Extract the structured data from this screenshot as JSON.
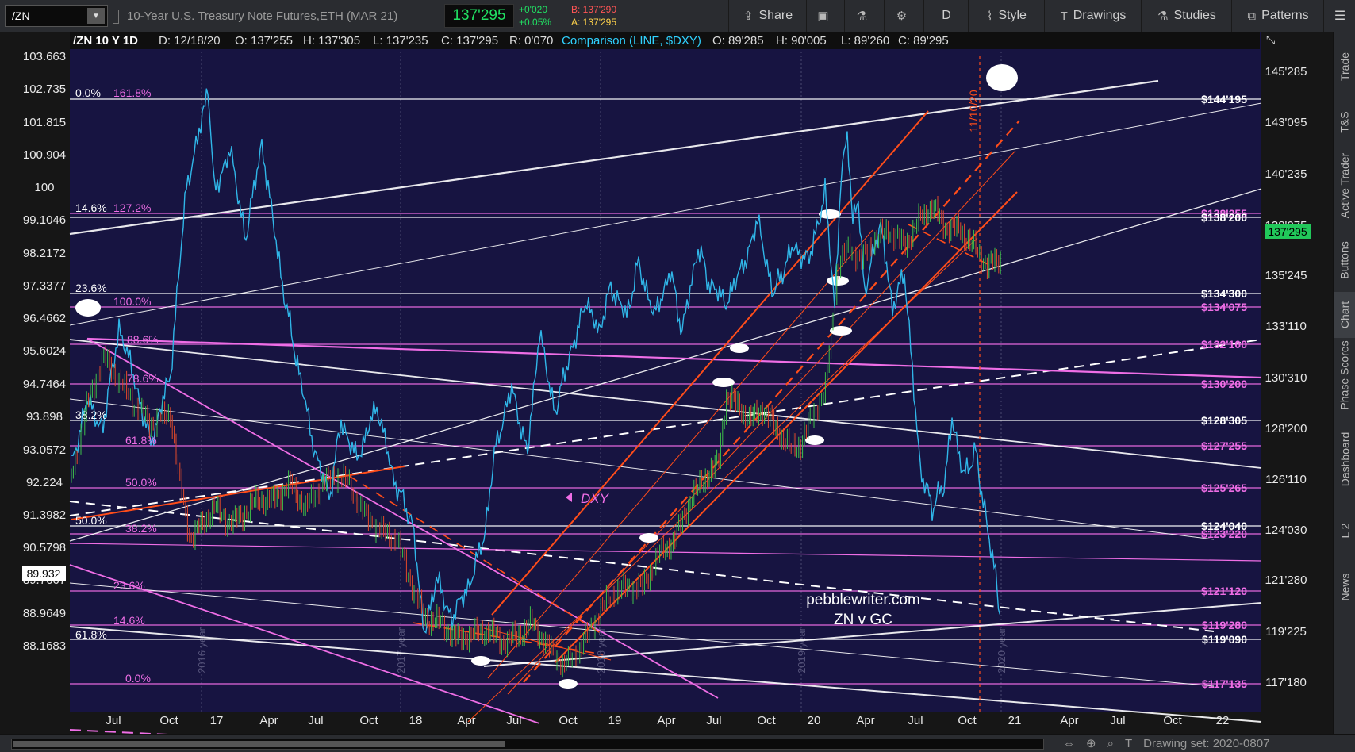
{
  "topbar": {
    "symbol": "/ZN",
    "description": "10-Year U.S. Treasury Note Futures,ETH (MAR 21)",
    "last_price": "137'295",
    "change_abs": "+0'020",
    "change_pct": "+0.05%",
    "bid": "B: 137'290",
    "ask": "A: 137'295",
    "share_label": "Share",
    "period_label": "D",
    "style_label": "Style",
    "drawings_label": "Drawings",
    "studies_label": "Studies",
    "patterns_label": "Patterns"
  },
  "right_panel": {
    "tabs": [
      "Trade",
      "T&S",
      "Active Trader",
      "Buttons",
      "Chart",
      "Phase Scores",
      "Dashboard",
      "L 2",
      "News"
    ],
    "active_tab": "Chart"
  },
  "bottom_bar": {
    "drawing_set": "Drawing set: 2020-0807"
  },
  "colors": {
    "background": "#171441",
    "price_candles_up": "#3ec24a",
    "price_candles_down": "#e44a2a",
    "comparison_line": "#30b6e8",
    "fib_magenta": "#ef6ee6",
    "white_lines": "#ffffff",
    "channel_red": "#ff4d1a"
  },
  "chart_data": {
    "type": "line",
    "header": {
      "symbol_period": "/ZN 10 Y 1D",
      "date": "D: 12/18/20",
      "open": "O: 137'255",
      "high": "H: 137'305",
      "low": "L: 137'235",
      "close": "C: 137'295",
      "range": "R: 0'070",
      "comparison_label": "Comparison (LINE, $DXY)",
      "cmp_open": "O: 89'285",
      "cmp_high": "H: 90'005",
      "cmp_low": "L: 89'260",
      "cmp_close": "C: 89'295"
    },
    "left_axis_ticks": [
      "103.663",
      "102.735",
      "101.815",
      "100.904",
      "100",
      "99.1046",
      "98.2172",
      "97.3377",
      "96.4662",
      "95.6024",
      "94.7464",
      "93.898",
      "93.0572",
      "92.224",
      "91.3982",
      "90.5798",
      "89.7667",
      "88.9649",
      "88.1683"
    ],
    "left_axis_current": "89.932",
    "right_axis_ticks": [
      "145'285",
      "143'095",
      "140'235",
      "138'075",
      "135'245",
      "133'110",
      "130'310",
      "128'200",
      "126'110",
      "124'030",
      "121'280",
      "119'225",
      "117'180"
    ],
    "right_axis_current": "137'295",
    "x_ticks": [
      "Jul",
      "Oct",
      "17",
      "Apr",
      "Jul",
      "Oct",
      "18",
      "Apr",
      "Jul",
      "Oct",
      "19",
      "Apr",
      "Jul",
      "Oct",
      "20",
      "Apr",
      "Jul",
      "Oct",
      "21",
      "Apr",
      "Jul",
      "Oct",
      "22"
    ],
    "year_markers": [
      "2016 year",
      "2017 year",
      "2018 year",
      "2019 year",
      "2020 year"
    ],
    "date_annotation": "11/10/20",
    "right_fib_levels": [
      {
        "label": "$144'195",
        "color": "white"
      },
      {
        "label": "$138'255",
        "color": "magenta"
      },
      {
        "label": "$138'200",
        "color": "white"
      },
      {
        "label": "$134'300",
        "color": "white"
      },
      {
        "label": "$134'075",
        "color": "magenta"
      },
      {
        "label": "$132'100",
        "color": "magenta"
      },
      {
        "label": "$130'200",
        "color": "magenta"
      },
      {
        "label": "$128'305",
        "color": "white"
      },
      {
        "label": "$127'255",
        "color": "magenta"
      },
      {
        "label": "$125'265",
        "color": "magenta"
      },
      {
        "label": "$124'040",
        "color": "white"
      },
      {
        "label": "$123'220",
        "color": "magenta"
      },
      {
        "label": "$121'120",
        "color": "magenta"
      },
      {
        "label": "$119'280",
        "color": "magenta"
      },
      {
        "label": "$119'090",
        "color": "white"
      },
      {
        "label": "$117'135",
        "color": "magenta"
      }
    ],
    "left_fib_labels": [
      {
        "label": "0.0%",
        "color": "white"
      },
      {
        "label": "161.8%",
        "color": "magenta"
      },
      {
        "label": "14.6%",
        "color": "white"
      },
      {
        "label": "127.2%",
        "color": "magenta"
      },
      {
        "label": "23.6%",
        "color": "white"
      },
      {
        "label": "100.0%",
        "color": "magenta"
      },
      {
        "label": "88.6%",
        "color": "magenta"
      },
      {
        "label": "78.6%",
        "color": "magenta"
      },
      {
        "label": "38.2%",
        "color": "white"
      },
      {
        "label": "61.8%",
        "color": "magenta"
      },
      {
        "label": "50.0%",
        "color": "magenta"
      },
      {
        "label": "50.0%",
        "color": "white"
      },
      {
        "label": "38.2%",
        "color": "magenta"
      },
      {
        "label": "23.6%",
        "color": "magenta"
      },
      {
        "label": "14.6%",
        "color": "magenta"
      },
      {
        "label": "61.8%",
        "color": "white"
      },
      {
        "label": "0.0%",
        "color": "magenta"
      }
    ],
    "annotations": {
      "dxy_label": "DXY",
      "watermark_line1": "pebblewriter.com",
      "watermark_line2": "ZN  v  GC"
    },
    "series": [
      {
        "name": "/ZN",
        "style": "candles"
      },
      {
        "name": "$DXY",
        "style": "line"
      }
    ]
  }
}
